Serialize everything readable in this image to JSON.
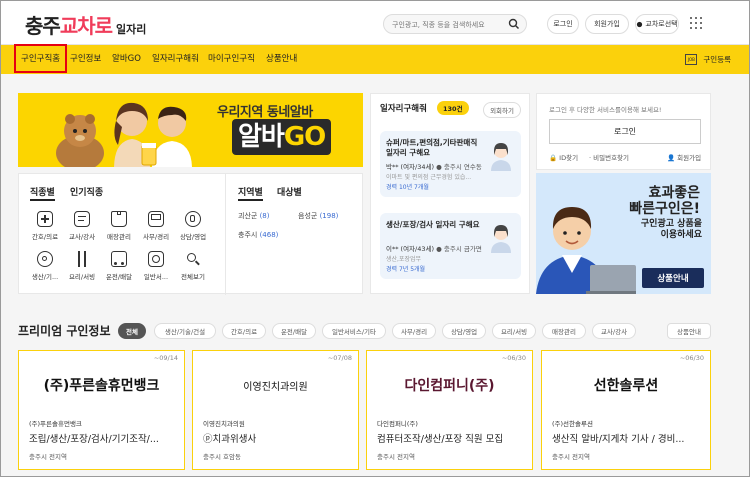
{
  "header": {
    "logo_part1": "충주",
    "logo_part2": "교차로",
    "logo_part3": "일자리",
    "search_placeholder": "구인광고, 직종 등을 검색하세요",
    "login": "로그인",
    "signup": "회원가입",
    "site_select": "교차로선택"
  },
  "nav": {
    "items": [
      "구인구직홈",
      "구인정보",
      "알바GO",
      "일자리구해줘",
      "마이구인구직",
      "상품안내"
    ],
    "register_icon_text": "JOB",
    "register": "구인등록"
  },
  "banner": {
    "tagline": "우리지역 동네알바",
    "brand_a": "알바",
    "brand_b": "GO"
  },
  "categories": {
    "tabs": [
      "직종별",
      "인기직종"
    ],
    "items": [
      "간호/의료",
      "교사/강사",
      "매장관리",
      "사무/경리",
      "상담/영업",
      "생산/기...",
      "요리/서빙",
      "운전/배달",
      "일반서...",
      "전체보기"
    ],
    "region_tabs": [
      "지역별",
      "대상별"
    ],
    "regions": [
      {
        "name": "괴산군",
        "count": "(8)"
      },
      {
        "name": "음성군",
        "count": "(198)"
      },
      {
        "name": "충주시",
        "count": "(468)"
      }
    ]
  },
  "jobs_wanted": {
    "title": "일자리구해줘",
    "count": "130건",
    "more": "외회하기",
    "cards": [
      {
        "title": "슈퍼/마트,편의점,기타판매직 일자리 구해요",
        "person": "박** (여자/34세)",
        "location": "충주시 연수동",
        "desc": "이마트 및 편의점 근무경험 있습...",
        "exp": "경력 10년 7개월"
      },
      {
        "title": "생산/포장/검사 일자리 구해요",
        "person": "이** (여자/43세)",
        "location": "충주시 금가면",
        "desc": "생산,포장업무",
        "exp": "경력 7년 5개월"
      }
    ]
  },
  "login_box": {
    "message": "로그인 후 다양한 서비스를이용해 보세요!",
    "button": "로그인",
    "find_id": "ID찾기",
    "find_pw": "비밀번호찾기",
    "join": "회원가입"
  },
  "promo": {
    "title_line1": "효과좋은",
    "title_line2": "빠른구인은!",
    "sub_line1": "구인광고 상품을",
    "sub_line2": "이용하세요",
    "button": "상품안내"
  },
  "premium": {
    "title": "프리미엄 구인정보",
    "chips": [
      "전체",
      "생산/기술/건설",
      "간호/의료",
      "운전/배달",
      "일반서비스/기타",
      "사무/경리",
      "상담/영업",
      "요리/서빙",
      "매장관리",
      "교사/강사"
    ],
    "guide": "상품안내",
    "cards": [
      {
        "date": "~09/14",
        "logo": "(주)푸른솔휴먼뱅크",
        "company": "(주)푸른솔휴먼뱅크",
        "title": "조립/생산/포장/검사/기기조작/...",
        "location": "충주시 전지역"
      },
      {
        "date": "~07/08",
        "logo": "이영진치과의원",
        "company": "이영진치과의원",
        "title": "ⓟ치과위생사",
        "location": "충주시 호암동"
      },
      {
        "date": "~06/30",
        "logo": "다인컴퍼니(주)",
        "company": "다인컴퍼니(주)",
        "title": "컴퓨터조작/생산/포장 직원 모집",
        "location": "충주시 전지역"
      },
      {
        "date": "~06/30",
        "logo": "선한솔루션",
        "company": "(주)선한솔루션",
        "title": "생산직 알바/지게차 기사 / 경비...",
        "location": "충주시 전지역"
      }
    ]
  }
}
